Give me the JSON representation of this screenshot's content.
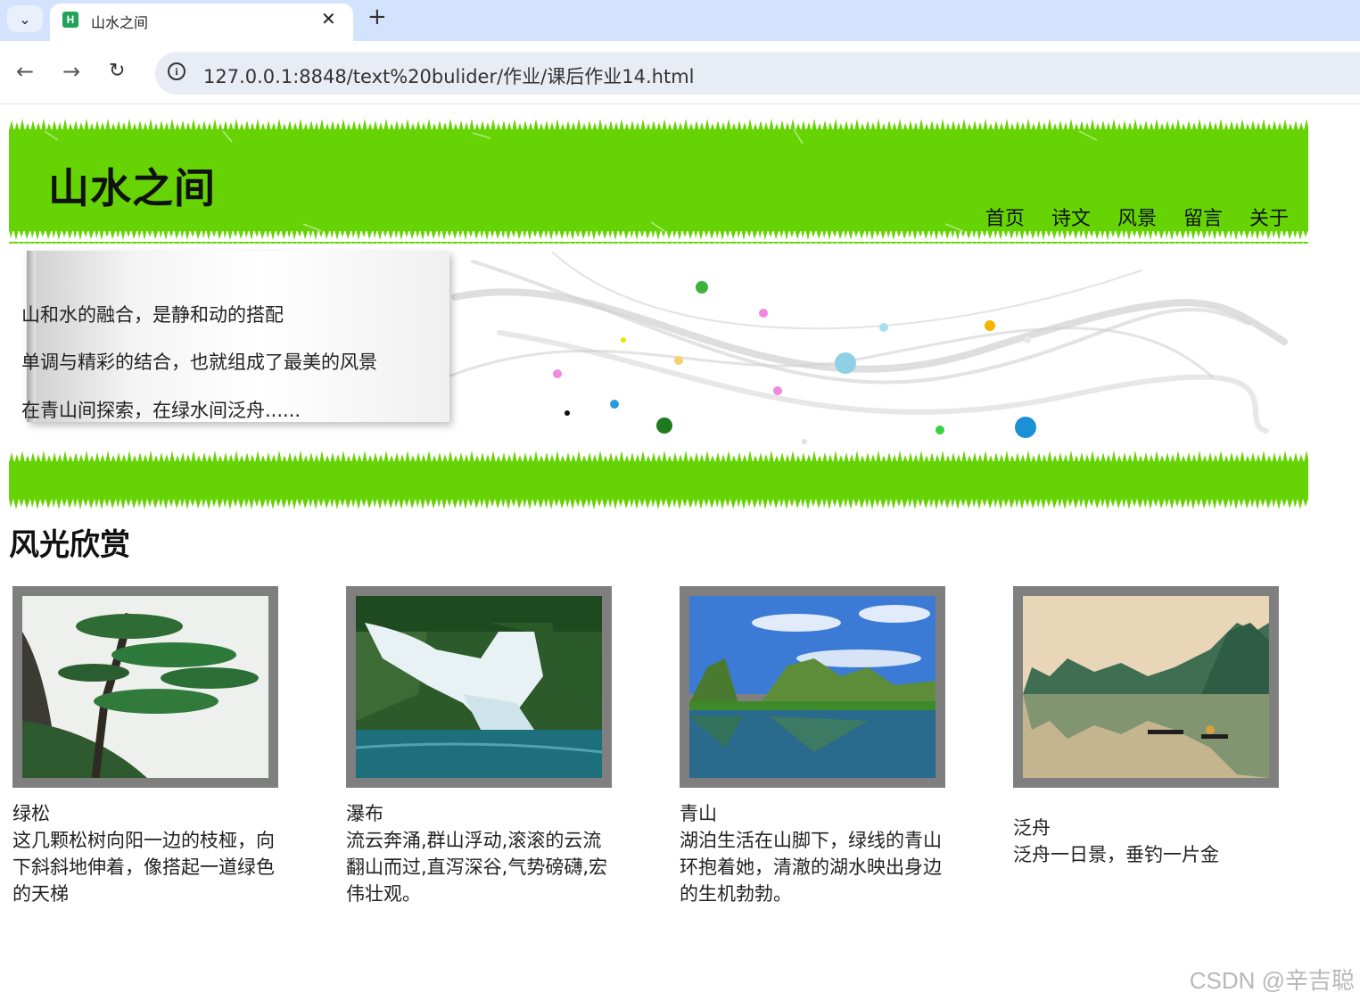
{
  "browser": {
    "tab_title": "山水之间",
    "url": "127.0.0.1:8848/text%20bulider/作业/课后作业14.html",
    "icons": {
      "tab_menu": "chevron-down-icon",
      "favicon": "hbuilder-icon",
      "close": "close-icon",
      "new_tab": "plus-icon",
      "back": "arrow-left-icon",
      "forward": "arrow-right-icon",
      "reload": "reload-icon",
      "site_info": "info-icon"
    },
    "glyphs": {
      "tab_menu": "⌄",
      "favicon": "H",
      "close": "✕",
      "new_tab": "+",
      "back": "←",
      "forward": "→",
      "reload": "↻",
      "site_info": "i"
    }
  },
  "header": {
    "title": "山水之间",
    "nav": [
      "首页",
      "诗文",
      "风景",
      "留言",
      "关于"
    ]
  },
  "banner": {
    "lines": [
      "山和水的融合，是静和动的搭配",
      "单调与精彩的结合，也就组成了最美的风景",
      "在青山间探索，在绿水间泛舟......"
    ]
  },
  "section": {
    "title": "风光欣赏"
  },
  "gallery": [
    {
      "name": "绿松",
      "desc": "这几颗松树向阳一边的枝桠，向下斜斜地伸着，像搭起一道绿色的天梯"
    },
    {
      "name": "瀑布",
      "desc": "流云奔涌,群山浮动,滚滚的云流翻山而过,直泻深谷,气势磅礴,宏伟壮观。"
    },
    {
      "name": "青山",
      "desc": "湖泊生活在山脚下，绿线的青山环抱着她，清澈的湖水映出身边的生机勃勃。"
    },
    {
      "name": "泛舟",
      "desc": "泛舟一日景，垂钓一片金"
    }
  ],
  "watermark": "CSDN @辛吉聪",
  "colors": {
    "header_green": "#66d404",
    "tab_bar": "#d3e3fd",
    "frame_gray": "#7f7f7f"
  }
}
